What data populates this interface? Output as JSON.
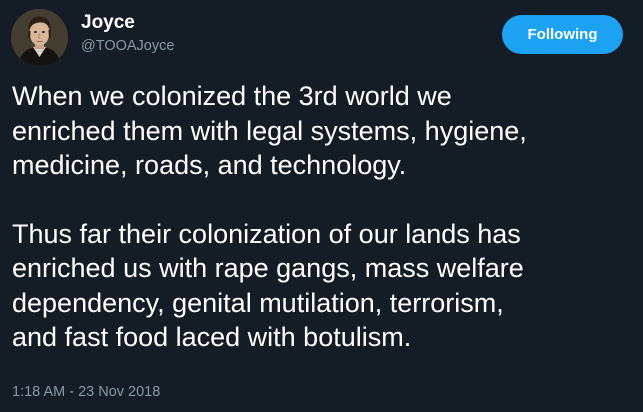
{
  "author": {
    "display_name": "Joyce",
    "handle": "@TOOAJoyce",
    "avatar_icon": "portrait-avatar"
  },
  "follow_button": {
    "label": "Following",
    "color": "#1da1f2"
  },
  "tweet": {
    "paragraph1_lines": [
      "When we colonized the 3rd world we",
      "enriched them with legal systems, hygiene,",
      "medicine, roads, and technology."
    ],
    "paragraph2_lines": [
      "Thus far their colonization of our lands has",
      "enriched us with rape gangs, mass welfare",
      "dependency, genital mutilation, terrorism,",
      "and fast food laced with botulism."
    ],
    "timestamp": "1:18 AM - 23 Nov 2018"
  },
  "colors": {
    "background": "#141d26",
    "text": "#ffffff",
    "secondary_text": "#8899a6"
  }
}
